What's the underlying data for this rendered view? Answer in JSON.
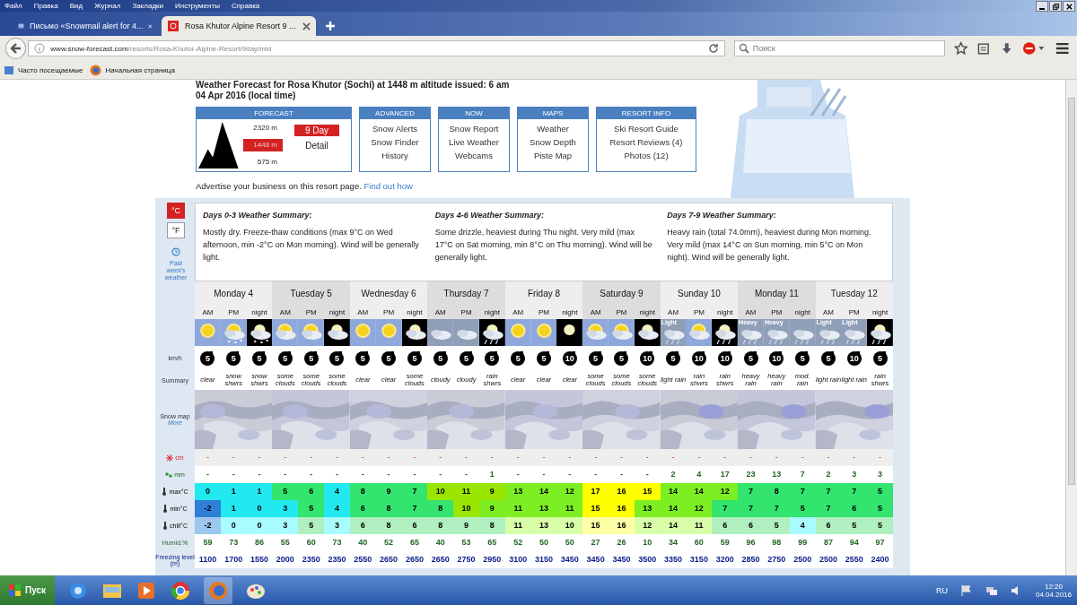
{
  "browser": {
    "menu": [
      "Файл",
      "Правка",
      "Вид",
      "Журнал",
      "Закладки",
      "Инструменты",
      "Справка"
    ],
    "tabs": [
      {
        "title": "Письмо «Snowmail alert for 4...",
        "selected": false
      },
      {
        "title": "Rosa Khutor Alpine Resort 9 ...",
        "selected": true
      }
    ],
    "url_host": "www.snow-forecast.com",
    "url_path": "/resorts/Rosa-Khutor-Alpine-Resort/9day/mid",
    "search_placeholder": "Поиск",
    "bookmarks": [
      "Часто посещаемые",
      "Начальная страница"
    ]
  },
  "header": {
    "title": "Weather Forecast for Rosa Khutor (Sochi) at 1448 m altitude issued: 6 am",
    "issued": "04 Apr 2016 (local time)",
    "forecast": {
      "title": "FORECAST",
      "elevations": [
        {
          "label": "2320 m",
          "selected": false
        },
        {
          "label": "1448 m",
          "selected": true
        },
        {
          "label": "575 m",
          "selected": false
        }
      ],
      "button": "9 Day",
      "detail": "Detail"
    },
    "nav": [
      {
        "title": "ADVANCED",
        "links": [
          "Snow Alerts",
          "Snow Finder",
          "History"
        ]
      },
      {
        "title": "NOW",
        "links": [
          "Snow Report",
          "Live Weather",
          "Webcams"
        ]
      },
      {
        "title": "MAPS",
        "links": [
          "Weather",
          "Snow Depth",
          "Piste Map"
        ]
      },
      {
        "title": "RESORT INFO",
        "links": [
          "Ski Resort Guide",
          "Resort Reviews (4)",
          "Photos (12)"
        ]
      }
    ],
    "advertise": "Advertise your business on this resort page.",
    "advertise_link": "Find out how"
  },
  "units": [
    {
      "label": "°C",
      "selected": true
    },
    {
      "label": "°F",
      "selected": false
    }
  ],
  "past_weather": "Past week's weather",
  "summaries": [
    {
      "title": "Days 0-3 Weather Summary:",
      "text": "Mostly dry. Freeze-thaw conditions (max 9°C on Wed afternoon, min -2°C on Mon morning). Wind will be generally light."
    },
    {
      "title": "Days 4-6 Weather Summary:",
      "text": "Some drizzle, heaviest during Thu night. Very mild (max 17°C on Sat morning, min 8°C on Thu morning). Wind will be generally light."
    },
    {
      "title": "Days 7-9 Weather Summary:",
      "text": "Heavy rain (total 74.0mm), heaviest during Mon morning. Very mild (max 14°C on Sun morning, min 5°C on Mon night). Wind will be generally light."
    }
  ],
  "labels": {
    "wind": "km/h",
    "summary": "Summary",
    "snow_map": "Snow map",
    "more": "More"
  },
  "days": [
    {
      "name": "Monday 4",
      "periods": [
        {
          "label": "AM",
          "kind": "sun",
          "wind": "5",
          "summary": "clear"
        },
        {
          "label": "PM",
          "kind": "sun-snow",
          "wind": "5",
          "summary": "snow shwrs"
        },
        {
          "label": "night",
          "kind": "night-snow",
          "wind": "5",
          "summary": "snow shwrs"
        }
      ]
    },
    {
      "name": "Tuesday 5",
      "periods": [
        {
          "label": "AM",
          "kind": "sun-cloud",
          "wind": "5",
          "summary": "some clouds"
        },
        {
          "label": "PM",
          "kind": "sun-cloud",
          "wind": "5",
          "summary": "some clouds"
        },
        {
          "label": "night",
          "kind": "night-cloud",
          "wind": "5",
          "summary": "some clouds"
        }
      ]
    },
    {
      "name": "Wednesday 6",
      "periods": [
        {
          "label": "AM",
          "kind": "sun",
          "wind": "5",
          "summary": "clear"
        },
        {
          "label": "PM",
          "kind": "sun",
          "wind": "5",
          "summary": "clear"
        },
        {
          "label": "night",
          "kind": "night-cloud",
          "wind": "5",
          "summary": "some clouds"
        }
      ]
    },
    {
      "name": "Thursday 7",
      "periods": [
        {
          "label": "AM",
          "kind": "cloud",
          "wind": "5",
          "summary": "cloudy"
        },
        {
          "label": "PM",
          "kind": "cloud",
          "wind": "5",
          "summary": "cloudy"
        },
        {
          "label": "night",
          "kind": "night-rain",
          "wind": "5",
          "summary": "rain shwrs"
        }
      ]
    },
    {
      "name": "Friday 8",
      "periods": [
        {
          "label": "AM",
          "kind": "sun",
          "wind": "5",
          "summary": "clear"
        },
        {
          "label": "PM",
          "kind": "sun",
          "wind": "5",
          "summary": "clear"
        },
        {
          "label": "night",
          "kind": "night",
          "wind": "10",
          "summary": "clear"
        }
      ]
    },
    {
      "name": "Saturday 9",
      "periods": [
        {
          "label": "AM",
          "kind": "sun-cloud",
          "wind": "5",
          "summary": "some clouds"
        },
        {
          "label": "PM",
          "kind": "sun-cloud",
          "wind": "5",
          "summary": "some clouds"
        },
        {
          "label": "night",
          "kind": "night-cloud",
          "wind": "10",
          "summary": "some clouds"
        }
      ]
    },
    {
      "name": "Sunday 10",
      "periods": [
        {
          "label": "AM",
          "kind": "rain",
          "icon_text": "Light",
          "wind": "5",
          "summary": "light rain"
        },
        {
          "label": "PM",
          "kind": "sun-cloud",
          "wind": "10",
          "summary": "rain shwrs"
        },
        {
          "label": "night",
          "kind": "night-rain",
          "wind": "10",
          "summary": "rain shwrs"
        }
      ]
    },
    {
      "name": "Monday 11",
      "periods": [
        {
          "label": "AM",
          "kind": "rain",
          "icon_text": "Heavy",
          "wind": "5",
          "summary": "heavy rain"
        },
        {
          "label": "PM",
          "kind": "rain",
          "icon_text": "Heavy",
          "wind": "10",
          "summary": "heavy rain"
        },
        {
          "label": "night",
          "kind": "rain",
          "wind": "5",
          "summary": "mod. rain"
        }
      ]
    },
    {
      "name": "Tuesday 12",
      "periods": [
        {
          "label": "AM",
          "kind": "rain",
          "icon_text": "Light",
          "wind": "5",
          "summary": "light rain"
        },
        {
          "label": "PM",
          "kind": "rain",
          "icon_text": "Light",
          "wind": "10",
          "summary": "light rain"
        },
        {
          "label": "night",
          "kind": "night-rain",
          "wind": "5",
          "summary": "rain shwrs"
        }
      ]
    }
  ],
  "rows": [
    {
      "kind": "snow",
      "label": "cm",
      "cells": [
        "-",
        "-",
        "-",
        "-",
        "-",
        "-",
        "-",
        "-",
        "-",
        "-",
        "-",
        "-",
        "-",
        "-",
        "-",
        "-",
        "-",
        "-",
        "-",
        "-",
        "-",
        "-",
        "-",
        "-",
        "-",
        "-",
        "-"
      ]
    },
    {
      "kind": "rain",
      "label": "mm",
      "cells": [
        "-",
        "-",
        "-",
        "-",
        "-",
        "-",
        "-",
        "-",
        "-",
        "-",
        "-",
        "1",
        "-",
        "-",
        "-",
        "-",
        "-",
        "-",
        "2",
        "4",
        "17",
        "23",
        "13",
        "7",
        "2",
        "3",
        "3"
      ]
    },
    {
      "kind": "temp",
      "label": "max°C",
      "cells": [
        {
          "value": "0",
          "color": "#22e8f0"
        },
        {
          "value": "1",
          "color": "#22e8f0"
        },
        {
          "value": "1",
          "color": "#22e8f0"
        },
        {
          "value": "5",
          "color": "#33e46e"
        },
        {
          "value": "6",
          "color": "#33e46e"
        },
        {
          "value": "4",
          "color": "#22e8f0"
        },
        {
          "value": "8",
          "color": "#33e46e"
        },
        {
          "value": "9",
          "color": "#33e46e"
        },
        {
          "value": "7",
          "color": "#33e46e"
        },
        {
          "value": "10",
          "color": "#9be600"
        },
        {
          "value": "11",
          "color": "#9be600"
        },
        {
          "value": "9",
          "color": "#9be600"
        },
        {
          "value": "13",
          "color": "#7cee22"
        },
        {
          "value": "14",
          "color": "#7cee22"
        },
        {
          "value": "12",
          "color": "#7cee22"
        },
        {
          "value": "17",
          "color": "#ffff00"
        },
        {
          "value": "16",
          "color": "#ffff00"
        },
        {
          "value": "15",
          "color": "#ffff00"
        },
        {
          "value": "14",
          "color": "#7cee22"
        },
        {
          "value": "14",
          "color": "#7cee22"
        },
        {
          "value": "12",
          "color": "#7cee22"
        },
        {
          "value": "7",
          "color": "#33e46e"
        },
        {
          "value": "8",
          "color": "#33e46e"
        },
        {
          "value": "7",
          "color": "#33e46e"
        },
        {
          "value": "7",
          "color": "#33e46e"
        },
        {
          "value": "7",
          "color": "#33e46e"
        },
        {
          "value": "5",
          "color": "#33e46e"
        }
      ]
    },
    {
      "kind": "temp",
      "label": "min°C",
      "cells": [
        {
          "value": "-2",
          "color": "#2f7fd6"
        },
        {
          "value": "1",
          "color": "#22e8f0"
        },
        {
          "value": "0",
          "color": "#22e8f0"
        },
        {
          "value": "3",
          "color": "#22e8f0"
        },
        {
          "value": "5",
          "color": "#33e46e"
        },
        {
          "value": "4",
          "color": "#22e8f0"
        },
        {
          "value": "6",
          "color": "#33e46e"
        },
        {
          "value": "8",
          "color": "#33e46e"
        },
        {
          "value": "7",
          "color": "#33e46e"
        },
        {
          "value": "8",
          "color": "#33e46e"
        },
        {
          "value": "10",
          "color": "#9be600"
        },
        {
          "value": "9",
          "color": "#7cee22"
        },
        {
          "value": "11",
          "color": "#7cee22"
        },
        {
          "value": "13",
          "color": "#7cee22"
        },
        {
          "value": "11",
          "color": "#7cee22"
        },
        {
          "value": "15",
          "color": "#ffff00"
        },
        {
          "value": "16",
          "color": "#ffff00"
        },
        {
          "value": "13",
          "color": "#7cee22"
        },
        {
          "value": "14",
          "color": "#7cee22"
        },
        {
          "value": "12",
          "color": "#7cee22"
        },
        {
          "value": "7",
          "color": "#33e46e"
        },
        {
          "value": "7",
          "color": "#33e46e"
        },
        {
          "value": "7",
          "color": "#33e46e"
        },
        {
          "value": "5",
          "color": "#33e46e"
        },
        {
          "value": "7",
          "color": "#33e46e"
        },
        {
          "value": "6",
          "color": "#33e46e"
        },
        {
          "value": "5",
          "color": "#33e46e"
        }
      ]
    },
    {
      "kind": "temp",
      "label": "chill°C",
      "cells": [
        {
          "value": "-2",
          "color": "#9cc8f0"
        },
        {
          "value": "0",
          "color": "#a8fbff"
        },
        {
          "value": "0",
          "color": "#a8fbff"
        },
        {
          "value": "3",
          "color": "#a8fbff"
        },
        {
          "value": "5",
          "color": "#b0f0c0"
        },
        {
          "value": "3",
          "color": "#a8fbff"
        },
        {
          "value": "6",
          "color": "#b0f0c0"
        },
        {
          "value": "8",
          "color": "#b0f0c0"
        },
        {
          "value": "6",
          "color": "#b0f0c0"
        },
        {
          "value": "8",
          "color": "#b0f0c0"
        },
        {
          "value": "9",
          "color": "#b0f0c0"
        },
        {
          "value": "8",
          "color": "#b0f0c0"
        },
        {
          "value": "11",
          "color": "#d8ffa8"
        },
        {
          "value": "13",
          "color": "#d8ffa8"
        },
        {
          "value": "10",
          "color": "#d8ffa8"
        },
        {
          "value": "15",
          "color": "#ffffa8"
        },
        {
          "value": "16",
          "color": "#ffffa8"
        },
        {
          "value": "12",
          "color": "#d8ffa8"
        },
        {
          "value": "14",
          "color": "#d8ffa8"
        },
        {
          "value": "11",
          "color": "#d8ffa8"
        },
        {
          "value": "6",
          "color": "#b0f0c0"
        },
        {
          "value": "6",
          "color": "#b0f0c0"
        },
        {
          "value": "5",
          "color": "#b0f0c0"
        },
        {
          "value": "4",
          "color": "#a8fbff"
        },
        {
          "value": "6",
          "color": "#b0f0c0"
        },
        {
          "value": "5",
          "color": "#b0f0c0"
        },
        {
          "value": "5",
          "color": "#b0f0c0"
        }
      ]
    },
    {
      "kind": "humid",
      "label": "Humid.%",
      "cells": [
        "59",
        "73",
        "86",
        "55",
        "60",
        "73",
        "40",
        "52",
        "65",
        "40",
        "53",
        "65",
        "52",
        "50",
        "50",
        "27",
        "26",
        "10",
        "34",
        "60",
        "59",
        "96",
        "98",
        "99",
        "87",
        "94",
        "97"
      ]
    },
    {
      "kind": "freeze",
      "label": "Freezing level (m)",
      "cells": [
        "1100",
        "1700",
        "1550",
        "2000",
        "2350",
        "2350",
        "2550",
        "2650",
        "2650",
        "2650",
        "2750",
        "2950",
        "3100",
        "3150",
        "3450",
        "3450",
        "3450",
        "3500",
        "3350",
        "3150",
        "3200",
        "2850",
        "2750",
        "2500",
        "2500",
        "2550",
        "2400"
      ]
    }
  ],
  "taskbar": {
    "start": "Пуск",
    "lang": "RU",
    "time": "12:20",
    "date": "04.04.2016"
  }
}
